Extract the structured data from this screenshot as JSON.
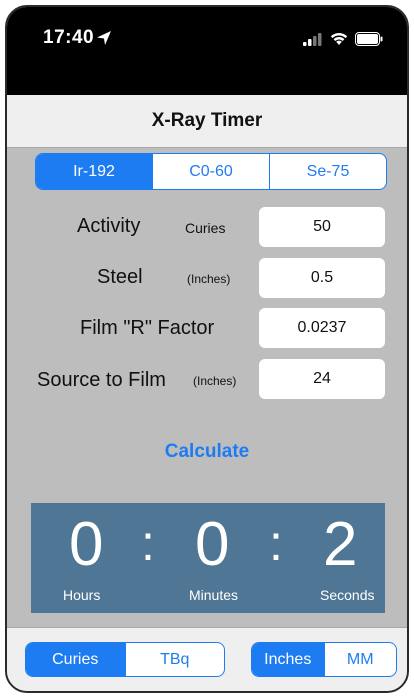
{
  "status_bar": {
    "time": "17:40",
    "icons": [
      "location-arrow-icon",
      "signal-icon",
      "wifi-icon",
      "battery-icon"
    ]
  },
  "nav": {
    "title": "X-Ray Timer"
  },
  "isotope_segment": {
    "options": [
      "Ir-192",
      "C0-60",
      "Se-75"
    ],
    "selected": "Ir-192"
  },
  "inputs": {
    "activity": {
      "label": "Activity",
      "unit": "Curies",
      "value": "50"
    },
    "steel": {
      "label": "Steel",
      "unit": "(Inches)",
      "value": "0.5"
    },
    "film_factor": {
      "label": "Film \"R\" Factor",
      "value": "0.0237"
    },
    "source_to_film": {
      "label": "Source to Film",
      "unit": "(Inches)",
      "value": "24"
    }
  },
  "calculate_label": "Calculate",
  "timer": {
    "hours": "0",
    "minutes": "0",
    "seconds": "2",
    "separator": ":",
    "hours_label": "Hours",
    "minutes_label": "Minutes",
    "seconds_label": "Seconds"
  },
  "unit_segment": {
    "options": [
      "Curies",
      "TBq"
    ],
    "selected": "Curies"
  },
  "length_segment": {
    "options": [
      "Inches",
      "MM"
    ],
    "selected": "Inches"
  },
  "colors": {
    "accent": "#1e7cf2",
    "timer_bg": "#4f7694",
    "background": "#bdbdbd"
  }
}
